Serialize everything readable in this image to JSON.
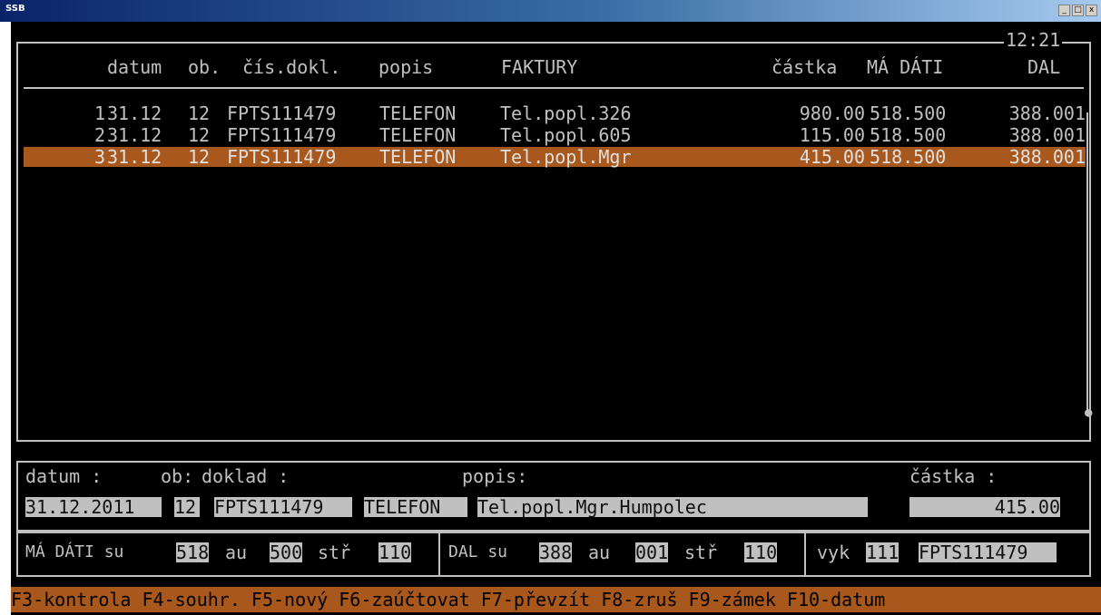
{
  "window": {
    "title": "SSB",
    "minimize": "_",
    "restore": "□",
    "close": "x"
  },
  "clock": "12:21",
  "header": {
    "row_no": "",
    "datum": "datum",
    "ob": "ob.",
    "cis_dokl": "čís.dokl.",
    "popis": "popis",
    "faktury": "FAKTURY",
    "castka": "částka",
    "ma_dati": "MÁ DÁTI",
    "dal": "DAL"
  },
  "rows": [
    {
      "no": "1",
      "datum": "31.12",
      "ob": "12",
      "doklad": "FPTS111479",
      "popis": "TELEFON",
      "text": "Tel.popl.326",
      "castka": "980.00",
      "ma_dati": "518.500",
      "dal": "388.001"
    },
    {
      "no": "2",
      "datum": "31.12",
      "ob": "12",
      "doklad": "FPTS111479",
      "popis": "TELEFON",
      "text": "Tel.popl.605",
      "castka": "115.00",
      "ma_dati": "518.500",
      "dal": "388.001"
    },
    {
      "no": "3",
      "datum": "31.12",
      "ob": "12",
      "doklad": "FPTS111479",
      "popis": "TELEFON",
      "text": "Tel.popl.Mgr",
      "castka": "415.00",
      "ma_dati": "518.500",
      "dal": "388.001"
    }
  ],
  "selected_row": "3",
  "detail": {
    "datum_label": "datum :",
    "ob_label": "ob:",
    "doklad_label": "doklad :",
    "popis_label": "popis:",
    "castka_label": "částka :",
    "datum": "31.12.2011",
    "ob": "12",
    "doklad": "FPTS111479",
    "popis": "TELEFON",
    "text": "Tel.popl.Mgr.Humpolec",
    "castka": "415.00"
  },
  "accounts": {
    "ma_dati_label": "MÁ DÁTI su",
    "ma_su": "518",
    "au_label": "au",
    "ma_au": "500",
    "str_label": "stř",
    "ma_str": "110",
    "dal_label": "DAL su",
    "dal_su": "388",
    "dal_au": "001",
    "dal_str": "110",
    "vyk_label": "vyk",
    "vyk": "111",
    "vyk_doklad": "FPTS111479"
  },
  "function_keys": "F3-kontrola F4-souhr. F5-nový F6-zaúčtovat F7-převzít F8-zruš F9-zámek F10-datum",
  "colors": {
    "highlight": "#a8581c",
    "text": "#c0c0c0",
    "background": "#000000"
  }
}
